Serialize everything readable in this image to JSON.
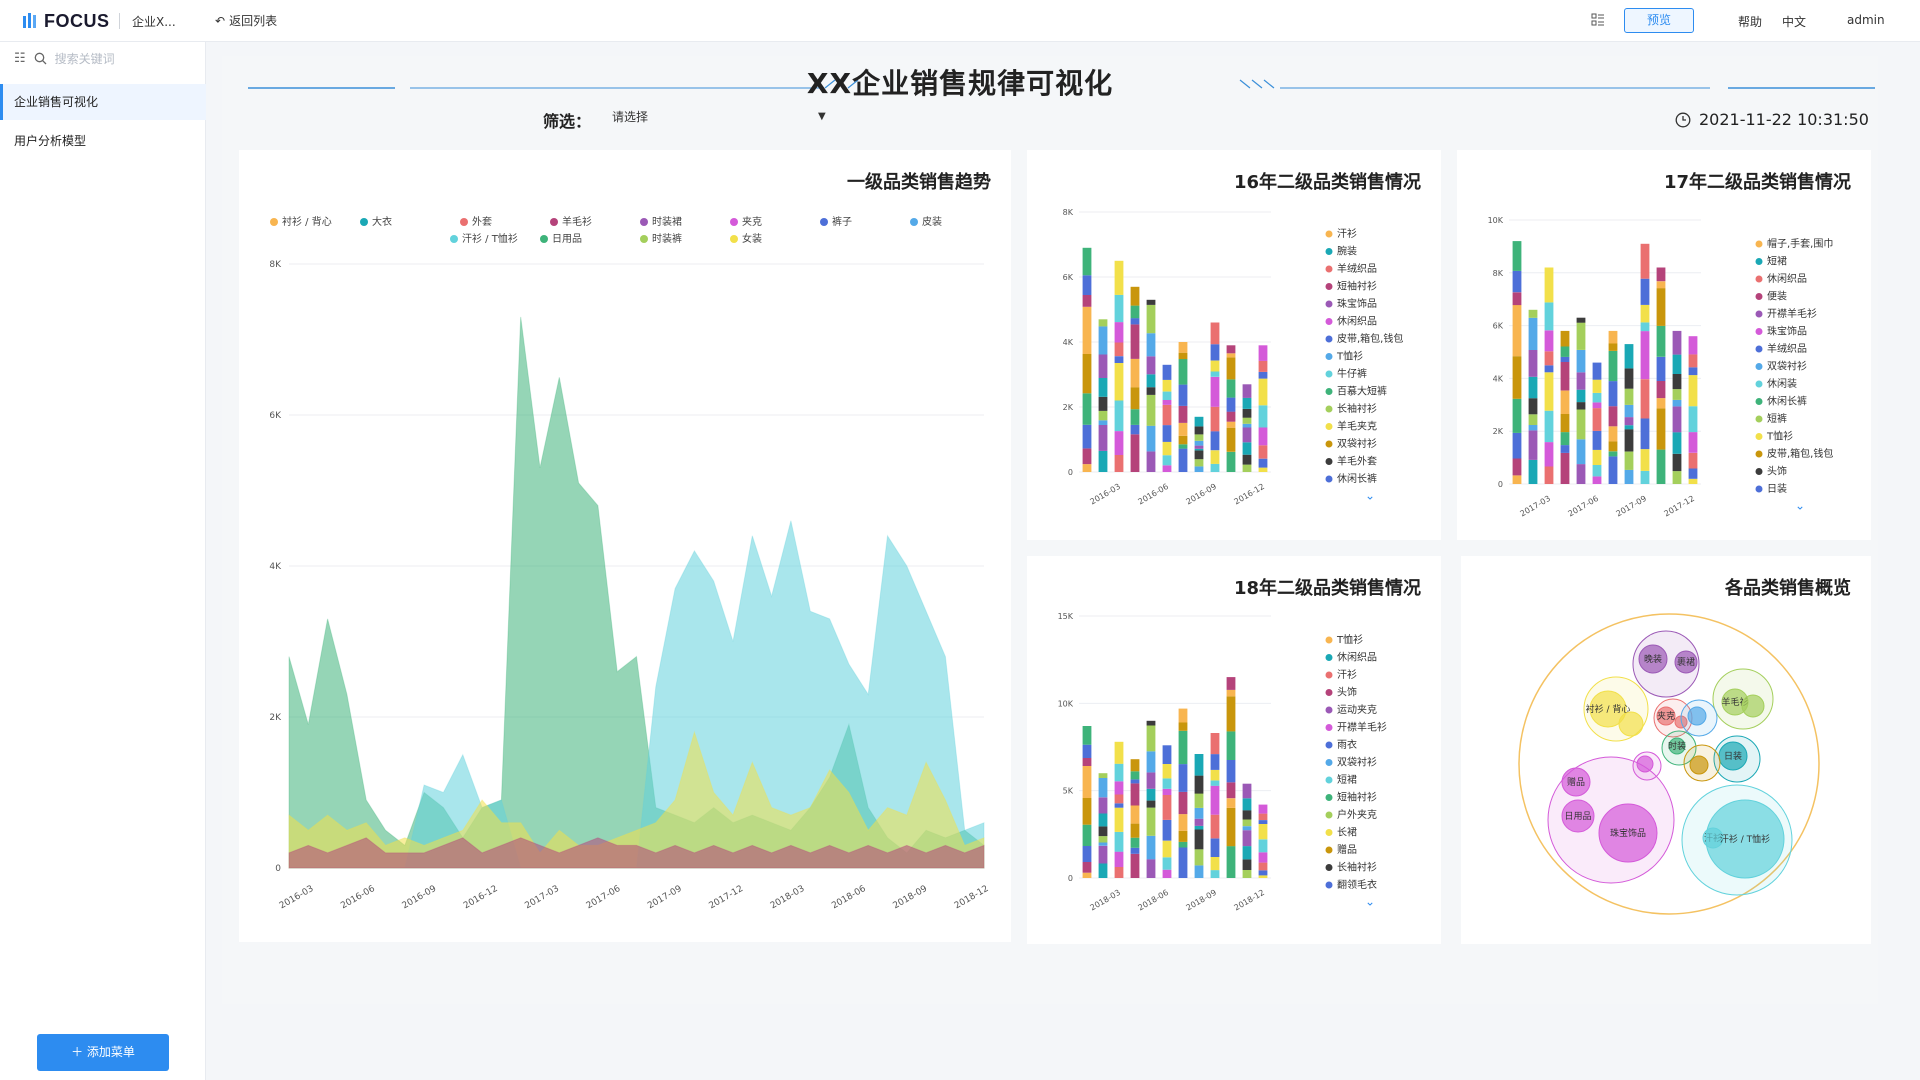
{
  "app": {
    "brand": "FOCUS",
    "crumb": "企业X...",
    "back": "返回列表"
  },
  "topbar": {
    "preview": "预览",
    "help": "帮助",
    "lang": "中文",
    "user": "admin"
  },
  "sidebar": {
    "search_placeholder": "搜索关键词",
    "items": [
      {
        "label": "企业销售可视化",
        "active": true
      },
      {
        "label": "用户分析模型",
        "active": false
      }
    ],
    "add": "＋ 添加菜单"
  },
  "dashboard": {
    "title": "XX企业销售规律可视化",
    "filter_label": "筛选：",
    "filter_placeholder": "请选择",
    "datetime": "2021-11-22 10:31:50"
  },
  "colors": {
    "accent": "#2d8cf0"
  },
  "chart_data": [
    {
      "type": "area",
      "title": "一级品类销售趋势",
      "x": [
        "2016-03",
        "2016-06",
        "2016-09",
        "2016-12",
        "2017-03",
        "2017-06",
        "2017-09",
        "2017-12",
        "2018-03",
        "2018-06",
        "2018-09",
        "2018-12"
      ],
      "ylim": [
        0,
        8000
      ],
      "yticks": [
        "0",
        "2K",
        "4K",
        "6K",
        "8K"
      ],
      "legend": [
        "衬衫 / 背心",
        "大衣",
        "外套",
        "羊毛衫",
        "时装裙",
        "夹克",
        "裤子",
        "皮装",
        "汗衫 / T恤衫",
        "日用品",
        "时装裤",
        "女装"
      ],
      "legend_colors": [
        "#f8b550",
        "#1aa8b5",
        "#ea7070",
        "#b5437a",
        "#9b59b6",
        "#d45ad9",
        "#4d6fd8",
        "#54a9e8",
        "#62d2dc",
        "#3eb37a",
        "#a4cf5c",
        "#f2e04a"
      ],
      "series": [
        {
          "name": "日用品",
          "color": "#3eb37a",
          "values": [
            2800,
            1900,
            3300,
            2300,
            900,
            500,
            300,
            1000,
            800,
            400,
            800,
            900,
            7300,
            5300,
            6500,
            5100,
            4800,
            2600,
            2800,
            800,
            700,
            600,
            800,
            600,
            700,
            600,
            500,
            800,
            1200,
            1900,
            800,
            400,
            200,
            500,
            400,
            500,
            300
          ]
        },
        {
          "name": "汗衫 / T恤衫",
          "color": "#62d2dc",
          "values": [
            0,
            0,
            0,
            0,
            0,
            0,
            0,
            1100,
            1000,
            1500,
            800,
            900,
            0,
            0,
            0,
            0,
            0,
            0,
            0,
            2400,
            3700,
            4200,
            3800,
            3000,
            4400,
            3600,
            4600,
            3400,
            3300,
            2700,
            2300,
            4400,
            4000,
            3400,
            2800,
            500,
            600
          ]
        },
        {
          "name": "女装",
          "color": "#f2e04a",
          "values": [
            700,
            500,
            700,
            500,
            600,
            300,
            400,
            300,
            400,
            500,
            900,
            600,
            600,
            200,
            500,
            300,
            300,
            400,
            500,
            600,
            900,
            1800,
            1000,
            700,
            1400,
            800,
            700,
            800,
            1300,
            1000,
            500,
            800,
            700,
            1400,
            900,
            300,
            400
          ]
        },
        {
          "name": "羊毛衫",
          "color": "#b5437a",
          "values": [
            200,
            300,
            200,
            300,
            400,
            200,
            200,
            200,
            300,
            400,
            200,
            300,
            400,
            300,
            200,
            300,
            400,
            300,
            300,
            200,
            300,
            200,
            300,
            200,
            300,
            200,
            300,
            200,
            300,
            200,
            300,
            200,
            300,
            200,
            300,
            200,
            300
          ]
        }
      ]
    },
    {
      "type": "bar",
      "title": "16年二级品类销售情况",
      "categories": [
        "2016-01",
        "2016-02",
        "2016-03",
        "2016-04",
        "2016-05",
        "2016-06",
        "2016-07",
        "2016-08",
        "2016-09",
        "2016-10",
        "2016-11",
        "2016-12"
      ],
      "x_tick_labels": [
        "2016-03",
        "2016-06",
        "2016-09",
        "2016-12"
      ],
      "ylim": [
        0,
        8000
      ],
      "yticks": [
        "0",
        "2K",
        "4K",
        "6K",
        "8K"
      ],
      "totals": [
        6900,
        4700,
        6500,
        5700,
        5300,
        3300,
        4000,
        1700,
        4600,
        3900,
        2700,
        3900
      ],
      "legend": [
        "汗衫",
        "腕装",
        "羊绒织品",
        "短袖衬衫",
        "珠宝饰品",
        "休闲织品",
        "皮带,箱包,钱包",
        "T恤衫",
        "牛仔裤",
        "百慕大短裤",
        "长袖衬衫",
        "羊毛夹克",
        "双袋衬衫",
        "羊毛外套",
        "休闲长裤"
      ],
      "legend_colors": [
        "#f8b550",
        "#1aa8b5",
        "#ea7070",
        "#b5437a",
        "#9b59b6",
        "#d45ad9",
        "#4d6fd8",
        "#54a9e8",
        "#62d2dc",
        "#3eb37a",
        "#a4cf5c",
        "#f2e04a",
        "#c9960c",
        "#3c3c3c",
        "#4d6fd8"
      ]
    },
    {
      "type": "bar",
      "title": "17年二级品类销售情况",
      "categories": [
        "2017-01",
        "2017-02",
        "2017-03",
        "2017-04",
        "2017-05",
        "2017-06",
        "2017-07",
        "2017-08",
        "2017-09",
        "2017-10",
        "2017-11",
        "2017-12"
      ],
      "x_tick_labels": [
        "2017-03",
        "2017-06",
        "2017-09",
        "2017-12"
      ],
      "ylim": [
        0,
        10000
      ],
      "yticks": [
        "0",
        "2K",
        "4K",
        "6K",
        "8K",
        "10K"
      ],
      "totals": [
        9200,
        6600,
        8200,
        5800,
        6300,
        4600,
        5800,
        5300,
        9100,
        8200,
        5800,
        5600
      ],
      "legend": [
        "帽子,手套,围巾",
        "短裙",
        "休闲织品",
        "便装",
        "开襟羊毛衫",
        "珠宝饰品",
        "羊绒织品",
        "双袋衬衫",
        "休闲装",
        "休闲长裤",
        "短裤",
        "T恤衫",
        "皮带,箱包,钱包",
        "头饰",
        "日装"
      ],
      "legend_colors": [
        "#f8b550",
        "#1aa8b5",
        "#ea7070",
        "#b5437a",
        "#9b59b6",
        "#d45ad9",
        "#4d6fd8",
        "#54a9e8",
        "#62d2dc",
        "#3eb37a",
        "#a4cf5c",
        "#f2e04a",
        "#c9960c",
        "#3c3c3c",
        "#4d6fd8"
      ]
    },
    {
      "type": "bar",
      "title": "18年二级品类销售情况",
      "categories": [
        "2018-01",
        "2018-02",
        "2018-03",
        "2018-04",
        "2018-05",
        "2018-06",
        "2018-07",
        "2018-08",
        "2018-09",
        "2018-10",
        "2018-11",
        "2018-12"
      ],
      "x_tick_labels": [
        "2018-03",
        "2018-06",
        "2018-09",
        "2018-12"
      ],
      "ylim": [
        0,
        15000
      ],
      "yticks": [
        "0",
        "5K",
        "10K",
        "15K"
      ],
      "totals": [
        8700,
        6000,
        7800,
        6800,
        9000,
        7600,
        9700,
        7100,
        8300,
        11500,
        5400,
        4200
      ],
      "legend": [
        "T恤衫",
        "休闲织品",
        "汗衫",
        "头饰",
        "运动夹克",
        "开襟羊毛衫",
        "雨衣",
        "双袋衬衫",
        "短裙",
        "短袖衬衫",
        "户外夹克",
        "长裙",
        "赠品",
        "长袖衬衫",
        "翻领毛衣"
      ],
      "legend_colors": [
        "#f8b550",
        "#1aa8b5",
        "#ea7070",
        "#b5437a",
        "#9b59b6",
        "#d45ad9",
        "#4d6fd8",
        "#54a9e8",
        "#62d2dc",
        "#3eb37a",
        "#a4cf5c",
        "#f2e04a",
        "#c9960c",
        "#3c3c3c",
        "#4d6fd8"
      ]
    },
    {
      "type": "bubble",
      "title": "各品类销售概览",
      "labels": [
        "晚装",
        "裹裙",
        "衬衫 / 背心",
        "羊毛衫",
        "夹克",
        "时装",
        "日装",
        "赠品",
        "日用品",
        "珠宝饰品",
        "汗衫",
        "汗衫 / T恤衫"
      ]
    }
  ]
}
